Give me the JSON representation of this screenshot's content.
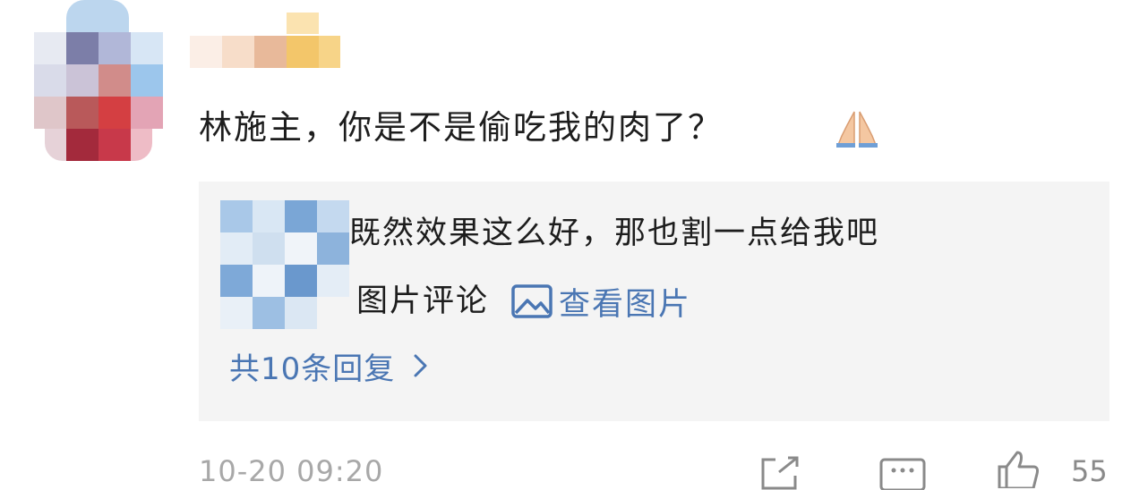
{
  "comment": {
    "text": "林施主，你是不是偷吃我的肉了？",
    "emoji_icon": "folded-hands-icon"
  },
  "reply": {
    "text": "既然效果这么好，那也割一点给我吧",
    "picture_label": "图片评论",
    "view_picture_link": "查看图片",
    "view_picture_icon": "image-icon",
    "total_replies_link": "共10条回复",
    "chevron_icon": "chevron-right-icon"
  },
  "footer": {
    "timestamp": "10-20 09:20",
    "share_icon": "share-icon",
    "comment_icon": "comment-icon",
    "like_icon": "thumbs-up-icon",
    "like_count": "55"
  },
  "colors": {
    "link": "#4a76b3",
    "reply_background": "#f4f4f4",
    "timestamp": "#a8a8a8"
  }
}
